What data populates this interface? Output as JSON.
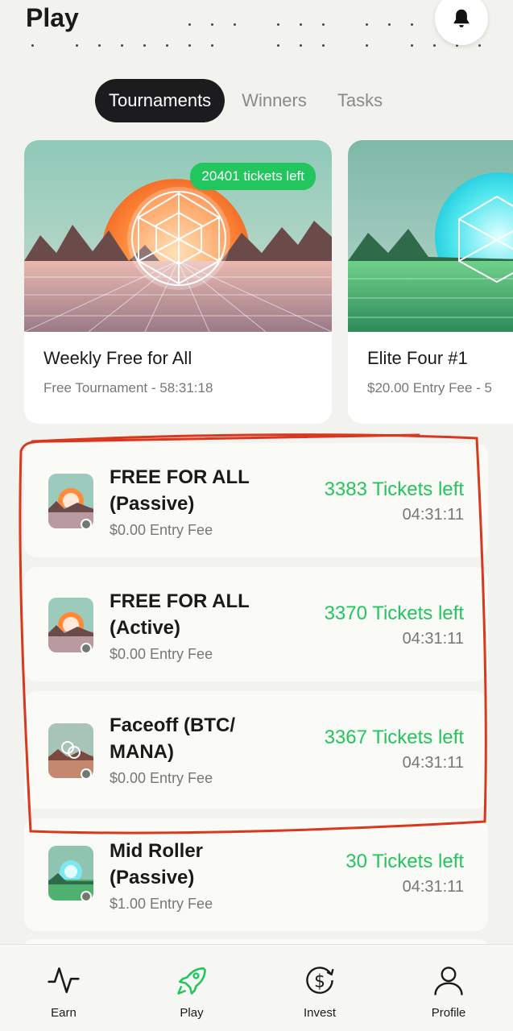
{
  "header": {
    "title": "Play"
  },
  "tabs": [
    {
      "label": "Tournaments",
      "active": true
    },
    {
      "label": "Winners",
      "active": false
    },
    {
      "label": "Tasks",
      "active": false
    }
  ],
  "featured": [
    {
      "badge": "20401 tickets left",
      "name": "Weekly Free for All",
      "subtitle": "Free Tournament - 58:31:18",
      "theme": "orange"
    },
    {
      "name": "Elite Four #1",
      "subtitle": "$20.00 Entry Fee - 5",
      "theme": "cyan"
    }
  ],
  "tournaments": [
    {
      "title": "FREE FOR ALL (Passive)",
      "fee": "$0.00 Entry Fee",
      "tickets": "3383 Tickets left",
      "time": "04:31:11"
    },
    {
      "title": "FREE FOR ALL (Active)",
      "fee": "$0.00 Entry Fee",
      "tickets": "3370 Tickets left",
      "time": "04:31:11"
    },
    {
      "title": "Faceoff (BTC/ MANA)",
      "fee": "$0.00 Entry Fee",
      "tickets": "3367 Tickets left",
      "time": "04:31:11"
    },
    {
      "title": "Mid Roller (Passive)",
      "fee": "$1.00 Entry Fee",
      "tickets": "30 Tickets left",
      "time": "04:31:11"
    }
  ],
  "nav": [
    {
      "label": "Earn",
      "icon": "activity-icon"
    },
    {
      "label": "Play",
      "icon": "rocket-icon",
      "active": true
    },
    {
      "label": "Invest",
      "icon": "dollar-cycle-icon"
    },
    {
      "label": "Profile",
      "icon": "user-icon"
    }
  ],
  "colors": {
    "accent": "#22c55e",
    "dark": "#1c1c1e",
    "highlight": "#d9381e"
  }
}
